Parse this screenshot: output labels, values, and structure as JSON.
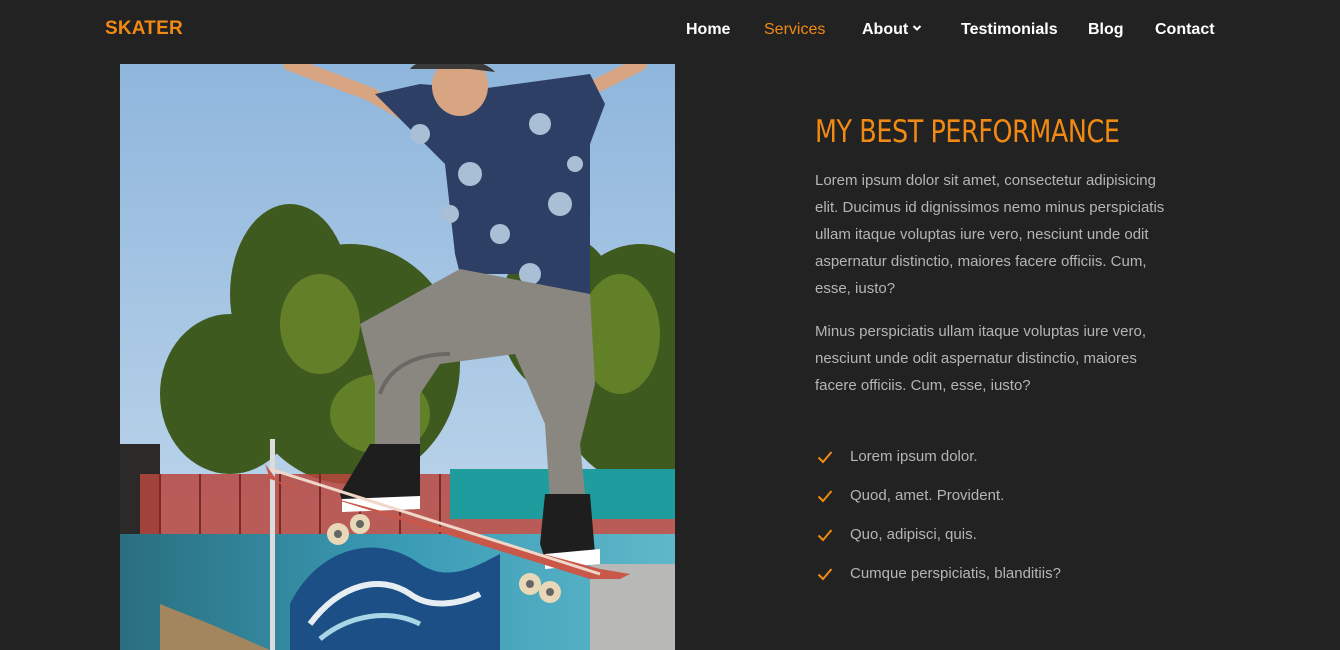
{
  "colors": {
    "background": "#222222",
    "accent": "#f18a12",
    "text": "#ffffff",
    "muted": "#b5b5b5"
  },
  "header": {
    "logo": "SKATER",
    "nav": [
      {
        "label": "Home",
        "active": false
      },
      {
        "label": "Services",
        "active": true
      },
      {
        "label": "About",
        "active": false,
        "dropdown": true,
        "icon": "chevron-down-icon"
      },
      {
        "label": "Testimonials",
        "active": false
      },
      {
        "label": "Blog",
        "active": false
      },
      {
        "label": "Contact",
        "active": false
      }
    ]
  },
  "main": {
    "image": "skateboarder-photo",
    "heading": "MY BEST PERFORMANCE",
    "paragraphs": [
      "Lorem ipsum dolor sit amet, consectetur adipisicing elit. Ducimus id dignissimos nemo minus perspiciatis ullam itaque voluptas iure vero, nesciunt unde odit aspernatur distinctio, maiores facere officiis. Cum, esse, iusto?",
      "Minus perspiciatis ullam itaque voluptas iure vero, nesciunt unde odit aspernatur distinctio, maiores facere officiis. Cum, esse, iusto?"
    ],
    "checklist_icon": "check-icon",
    "checklist": [
      "Lorem ipsum dolor.",
      "Quod, amet. Provident.",
      "Quo, adipisci, quis.",
      "Cumque perspiciatis, blanditiis?"
    ]
  }
}
